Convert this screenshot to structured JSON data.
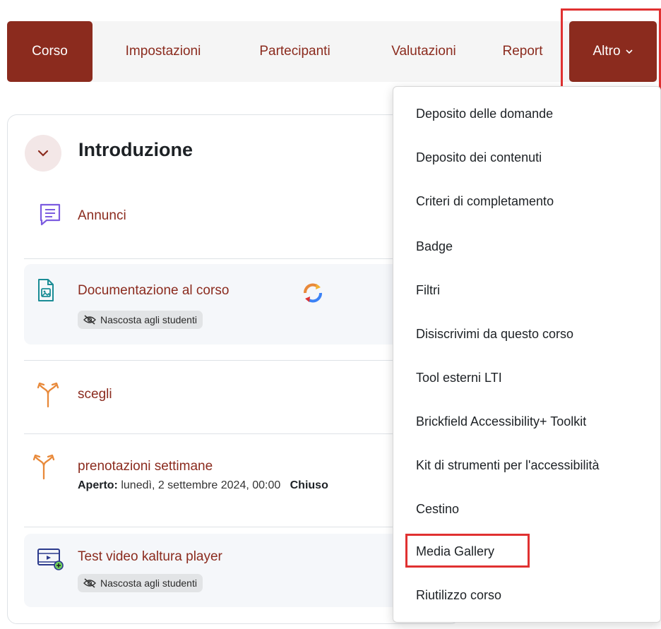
{
  "nav": {
    "tabs": [
      {
        "label": "Corso"
      },
      {
        "label": "Impostazioni"
      },
      {
        "label": "Partecipanti"
      },
      {
        "label": "Valutazioni"
      },
      {
        "label": "Report"
      },
      {
        "label": "Altro"
      }
    ]
  },
  "section": {
    "title": "Introduzione",
    "activities": [
      {
        "name": "Annunci",
        "icon": "forum-icon"
      },
      {
        "name": "Documentazione al corso",
        "icon": "file-image-icon",
        "badge": "Nascosta agli studenti",
        "status_icon": "sync-icon"
      },
      {
        "name": "scegli",
        "icon": "choice-icon"
      },
      {
        "name": "prenotazioni settimane",
        "icon": "choice-icon",
        "open_label": "Aperto:",
        "open_date": "lunedì, 2 settembre 2024, 00:00",
        "close_label": "Chiuso"
      },
      {
        "name": "Test video kaltura player",
        "icon": "video-icon",
        "badge": "Nascosta agli studenti"
      }
    ]
  },
  "dropdown": {
    "items": [
      {
        "label": "Deposito delle domande"
      },
      {
        "label": "Deposito dei contenuti"
      },
      {
        "label": "Criteri di completamento"
      },
      {
        "label": "Badge"
      },
      {
        "label": "Filtri"
      },
      {
        "label": "Disiscrivimi da questo corso"
      },
      {
        "label": "Tool esterni LTI"
      },
      {
        "label": "Brickfield Accessibility+ Toolkit"
      },
      {
        "label": "Kit di strumenti per l'accessibilità"
      },
      {
        "label": "Cestino"
      },
      {
        "label": "Media Gallery"
      },
      {
        "label": "Riutilizzo corso"
      }
    ]
  },
  "colors": {
    "brand": "#8b2b1e",
    "highlight": "#e03131",
    "forum_icon": "#7c5ce0",
    "file_icon": "#1a8c95",
    "choice_icon": "#e8893a",
    "video_icon": "#2b3a8c"
  }
}
